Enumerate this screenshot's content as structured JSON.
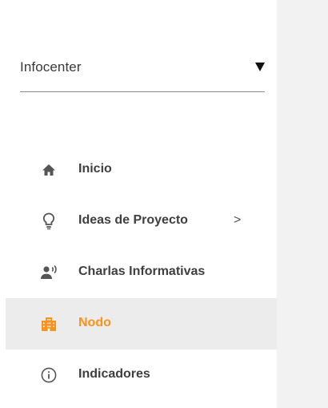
{
  "nodo_selector": {
    "value": "Infocenter",
    "icon": "dropdown-arrow-icon"
  },
  "nav": {
    "items": [
      {
        "label": "Inicio",
        "icon": "home-icon",
        "active": false
      },
      {
        "label": "Ideas de Proyecto",
        "icon": "lightbulb-icon",
        "active": false,
        "chevron": ">"
      },
      {
        "label": "Charlas Informativas",
        "icon": "record-voice-icon",
        "active": false
      },
      {
        "label": "Nodo",
        "icon": "building-icon",
        "active": true
      },
      {
        "label": "Indicadores",
        "icon": "info-icon",
        "active": false
      }
    ]
  },
  "colors": {
    "active": "#f7931e",
    "text": "#3f3f3f",
    "icon": "#555555",
    "active_background": "#ececec",
    "content_background": "#f2f2f2"
  }
}
